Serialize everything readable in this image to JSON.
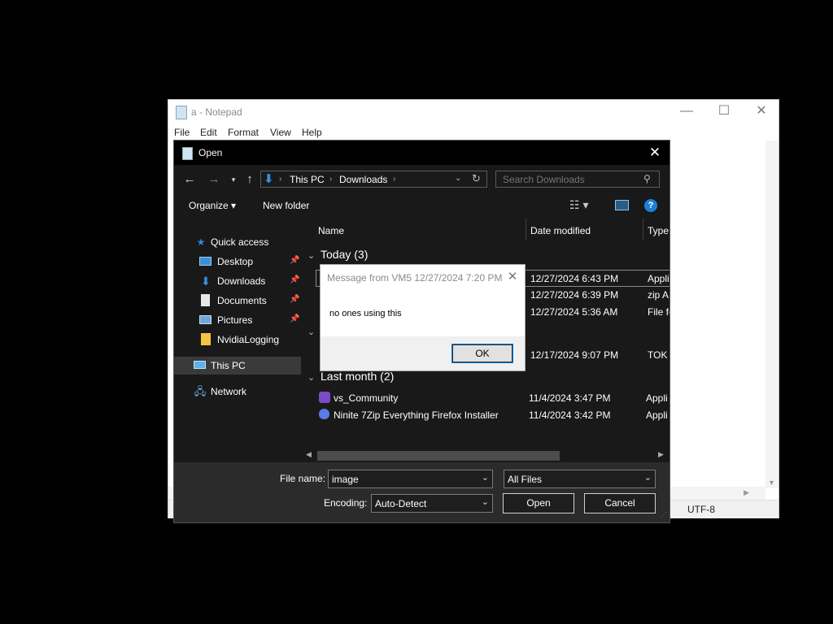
{
  "notepad": {
    "title": "a - Notepad",
    "menu": [
      "File",
      "Edit",
      "Format",
      "View",
      "Help"
    ],
    "window_buttons": {
      "minimize": "—",
      "maximize": "☐",
      "close": "✕"
    },
    "status_encoding": "UTF-8"
  },
  "open_dialog": {
    "title": "Open",
    "address": {
      "segments": [
        "This PC",
        "Downloads"
      ]
    },
    "search": {
      "placeholder": "Search Downloads"
    },
    "toolbar": {
      "organize": "Organize ▾",
      "new_folder": "New folder"
    },
    "nav_items": [
      {
        "label": "Quick access",
        "icon": "star-icon",
        "color": "#2e8ae6"
      },
      {
        "label": "Desktop",
        "icon": "desktop-icon",
        "color": "#3a8fd9",
        "pinned": true
      },
      {
        "label": "Downloads",
        "icon": "download-arrow-icon",
        "color": "#3a8fd9",
        "pinned": true
      },
      {
        "label": "Documents",
        "icon": "document-icon",
        "color": "#cfcfcf",
        "pinned": true
      },
      {
        "label": "Pictures",
        "icon": "pictures-icon",
        "color": "#6fa8dc",
        "pinned": true
      },
      {
        "label": "NvidiaLogging",
        "icon": "folder-icon",
        "color": "#f4c542"
      },
      {
        "label": "This PC",
        "icon": "computer-icon",
        "color": "#5fb0e8",
        "selected": true
      },
      {
        "label": "Network",
        "icon": "network-icon",
        "color": "#5fb0e8"
      }
    ],
    "columns": {
      "name": "Name",
      "date": "Date modified",
      "type": "Type"
    },
    "groups": [
      {
        "label": "Today (3)",
        "rows": [
          {
            "date": "12/27/2024 6:43 PM",
            "type": "Appli"
          },
          {
            "date": "12/27/2024 6:39 PM",
            "type": "zip A"
          },
          {
            "date": "12/27/2024 5:36 AM",
            "type": "File fo"
          }
        ]
      },
      {
        "label": "",
        "rows": [
          {
            "date": "12/17/2024 9:07 PM",
            "type": "TOK F"
          }
        ]
      },
      {
        "label": "Last month (2)",
        "rows": [
          {
            "name": "vs_Community",
            "date": "11/4/2024 3:47 PM",
            "type": "Appli"
          },
          {
            "name": "Ninite 7Zip Everything Firefox Installer",
            "date": "11/4/2024 3:42 PM",
            "type": "Appli"
          }
        ]
      }
    ],
    "file_name": {
      "label": "File name:",
      "value": "image"
    },
    "filter": {
      "value": "All Files"
    },
    "encoding": {
      "label": "Encoding:",
      "value": "Auto-Detect"
    },
    "buttons": {
      "open": "Open",
      "cancel": "Cancel"
    }
  },
  "message_box": {
    "title": "Message from VM5 12/27/2024 7:20 PM",
    "text": "no ones using this",
    "ok": "OK"
  }
}
